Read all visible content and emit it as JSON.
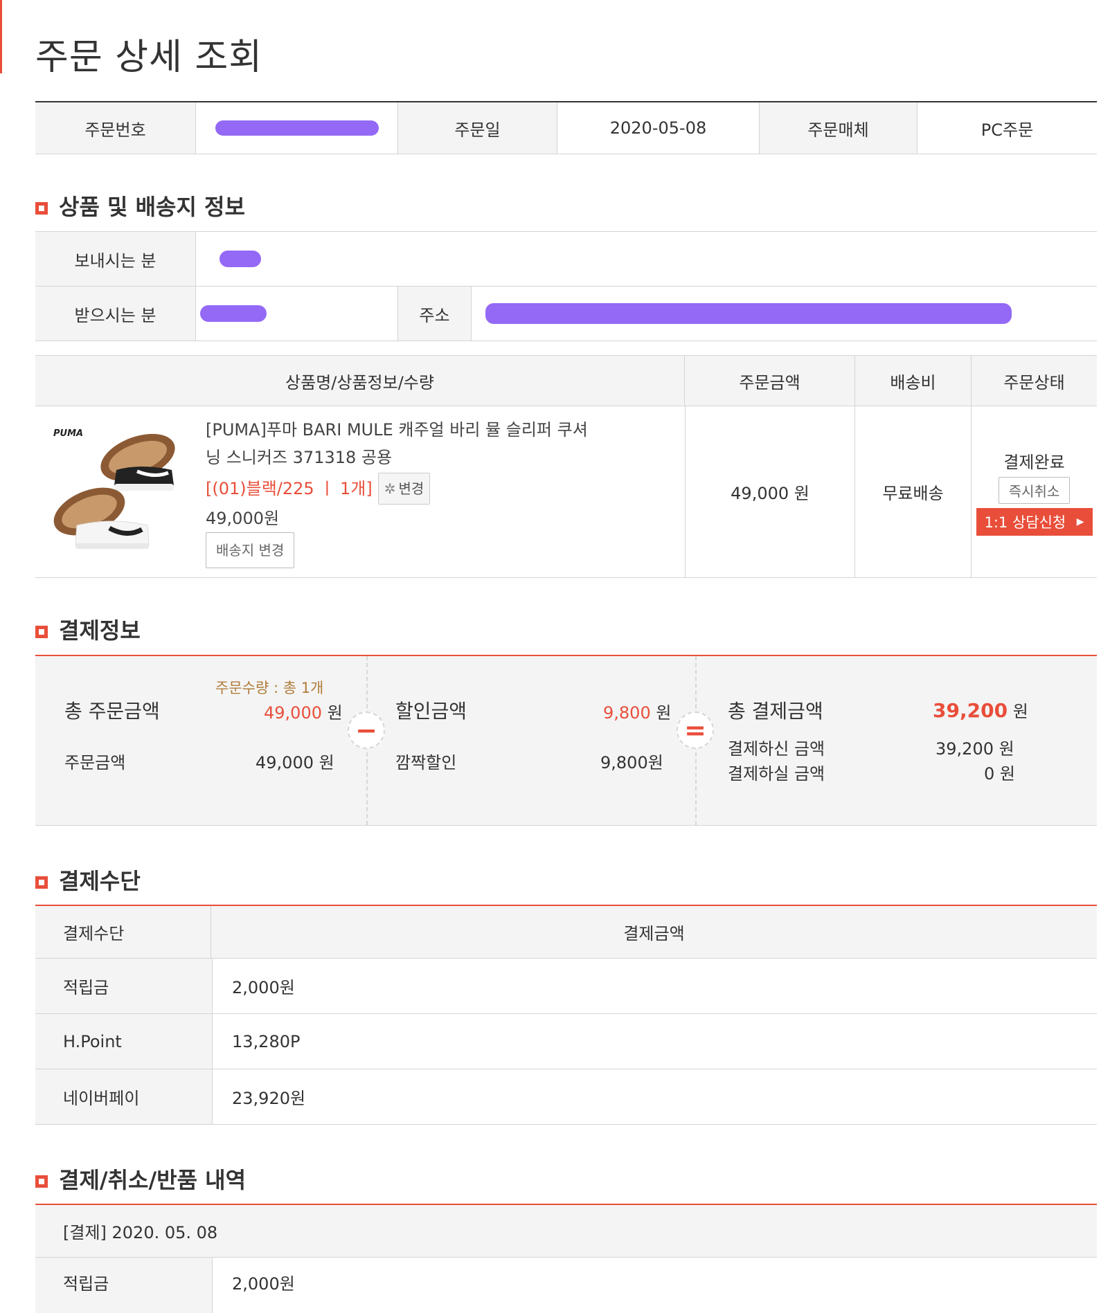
{
  "page": {
    "title": "주문 상세 조회"
  },
  "summary": {
    "order_no_label": "주문번호",
    "order_date_label": "주문일",
    "order_date": "2020-05-08",
    "channel_label": "주문매체",
    "channel": "PC주문"
  },
  "shipping": {
    "section_title": "상품 및 배송지 정보",
    "sender_label": "보내시는 분",
    "receiver_label": "받으시는 분",
    "address_label": "주소"
  },
  "product_table": {
    "headers": [
      "상품명/상품정보/수량",
      "주문금액",
      "배송비",
      "주문상태"
    ],
    "item": {
      "brand_logo": "PUMA",
      "name_line1": "[PUMA]푸마 BARI MULE 캐주얼 바리 뮬 슬리퍼 쿠셔",
      "name_line2": "닝 스니커즈 371318 공용",
      "option": "[(01)블랙/225 ㅣ 1개]",
      "change_button": "변경",
      "price": "49,000원",
      "address_change_button": "배송지 변경",
      "order_amount": "49,000 원",
      "shipping_fee": "무료배송",
      "status": "결제완료",
      "instant_cancel_button": "즉시취소",
      "inquiry_button": "1:1 상담신청"
    }
  },
  "payment_info": {
    "section_title": "결제정보",
    "order_qty": "주문수량 : 총 1개",
    "total_order_label": "총 주문금액",
    "total_order_amount": "49,000",
    "unit": "원",
    "order_amount_label": "주문금액",
    "order_amount": "49,000 원",
    "discount_label": "할인금액",
    "discount_amount": "9,800",
    "flash_discount_label": "깜짝할인",
    "flash_discount_amount": "9,800원",
    "total_payment_label": "총 결제금액",
    "total_payment_amount": "39,200",
    "paid_label": "결제하신 금액",
    "paid_amount": "39,200 원",
    "to_pay_label": "결제하실 금액",
    "to_pay_amount": "0 원",
    "minus_symbol": "−",
    "equals_symbol": "="
  },
  "payment_method": {
    "section_title": "결제수단",
    "headers": [
      "결제수단",
      "결제금액"
    ],
    "rows": [
      {
        "method": "적립금",
        "amount": "2,000원"
      },
      {
        "method": "H.Point",
        "amount": "13,280P"
      },
      {
        "method": "네이버페이",
        "amount": "23,920원"
      }
    ]
  },
  "history": {
    "section_title": "결제/취소/반품 내역",
    "entry_header": "[결제] 2020. 05. 08",
    "first_row_method": "적립금",
    "first_row_amount": "2,000원"
  },
  "colors": {
    "accent": "#e94e3a",
    "redaction": "#8a5cf5",
    "option_text": "#e94e3a",
    "qty_text": "#b07c3a"
  }
}
